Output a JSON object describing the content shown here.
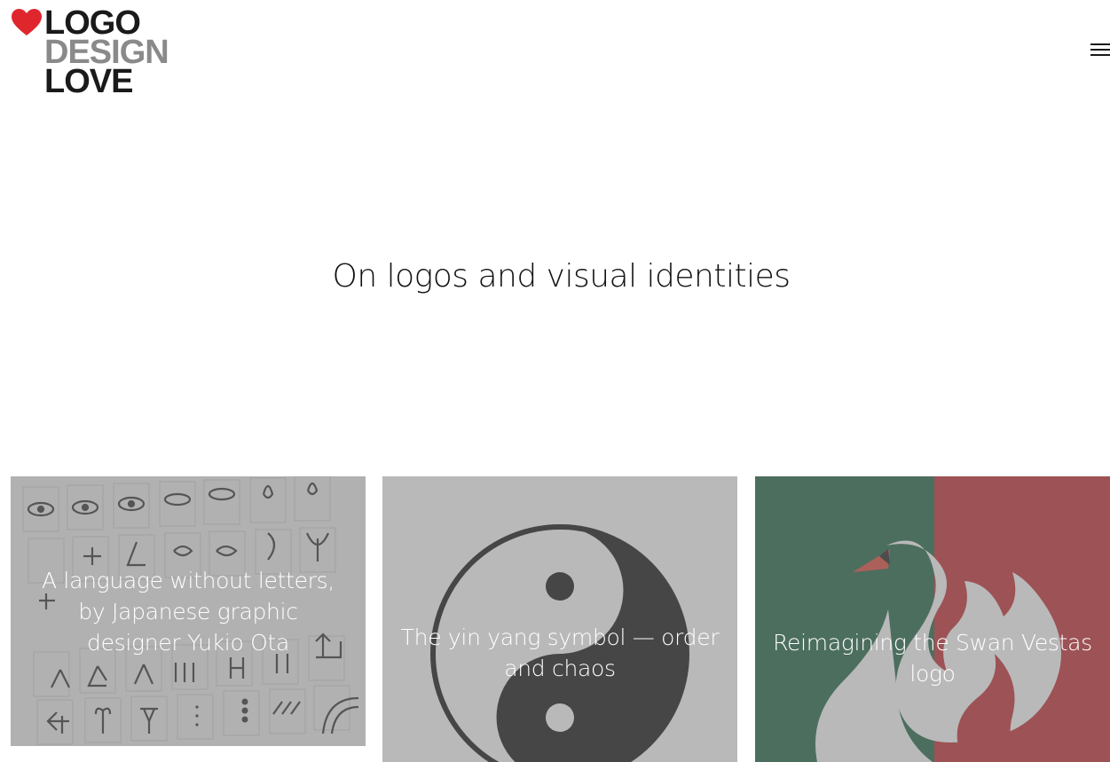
{
  "site": {
    "logo": {
      "line1": "LOGO",
      "line2": "DESIGN",
      "line3": "LOVE",
      "heart_color": "#e0262d"
    },
    "menu_icon": "hamburger-menu-icon"
  },
  "hero": {
    "title": "On logos and visual identities"
  },
  "cards": [
    {
      "title": "A language without letters, by Japanese graphic designer Yukio Ota",
      "image": "pictogram-grid"
    },
    {
      "title": "The yin yang symbol — order and chaos",
      "image": "yin-yang"
    },
    {
      "title": "Reimagining the Swan Vestas logo",
      "image": "swan",
      "colors": {
        "green": "#0e5a38",
        "red": "#8c1118"
      }
    }
  ]
}
